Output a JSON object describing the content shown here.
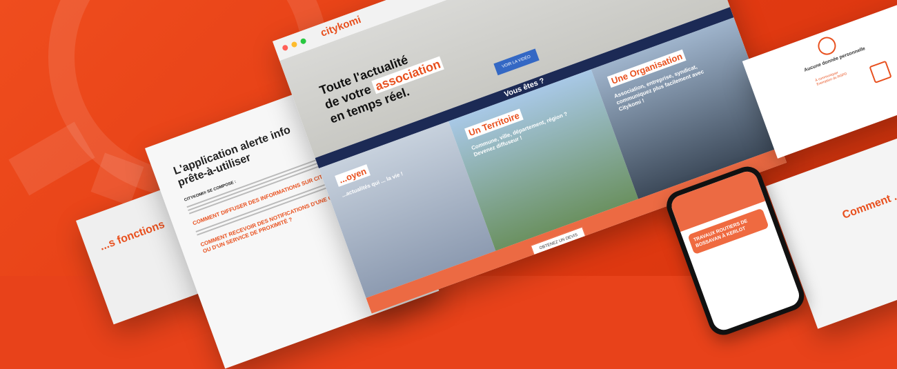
{
  "brand": {
    "name": "citykomi",
    "accent": "#e8501e",
    "navy": "#1c2a55"
  },
  "article": {
    "heading": "L'application alerte info prête-à-utiliser",
    "intro_label": "CITYKOMI® SE COMPOSE :",
    "question_1": "COMMENT DIFFUSER DES INFORMATIONS SUR CITYKOMI® ?",
    "question_2": "COMMENT RECEVOIR DES NOTIFICATIONS D'UNE COMMUNE OU D'UN SERVICE DE PROXIMITÉ ?"
  },
  "side_page": {
    "title": "...s fonctions"
  },
  "browser": {
    "hero_line_1": "Toute l'actualité",
    "hero_line_2": "de votre",
    "hero_highlight": "association",
    "hero_line_3": "en temps réel.",
    "video_button": "VOIR LA VIDÉO",
    "band_title": "Vous êtes ?",
    "panels": [
      {
        "title": "...oyen",
        "text": "...actualités qui ... la vie !"
      },
      {
        "title": "Un Territoire",
        "text": "Commune, ville, département, région ? Devenez diffuseur !"
      },
      {
        "title": "Une Organisation",
        "text": "Association, entreprise, syndicat, communiquez plus facilement avec Citykomi !"
      }
    ],
    "quote_button": "OBTENEZ UN DEVIS"
  },
  "card": {
    "title": "Aucune donnée personnelle",
    "subtitle": "À communiquer Exemption du RGPD"
  },
  "right_page": {
    "title": "Comment ... citoy..."
  },
  "phone": {
    "notification_title": "TRAVAUX ROUTIERS DE BOSSAVAN À KERLOT"
  }
}
